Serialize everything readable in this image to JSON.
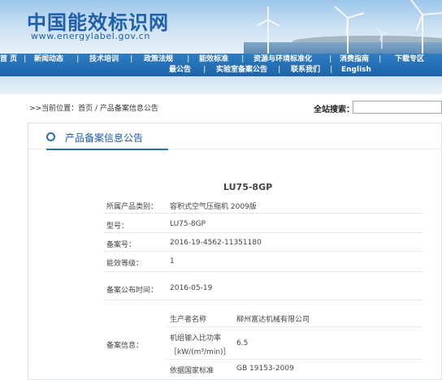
{
  "header": {
    "logo_title": "中国能效标识网",
    "logo_url": "www.energylabel.gov.cn"
  },
  "nav": {
    "row1": [
      "首 页",
      "新闻动态",
      "技术培训",
      "政策法规",
      "能效标准",
      "资源与环境标准化",
      "消费指南",
      "下载专区"
    ],
    "row2": [
      "最公告",
      "实验室备案公告",
      "联系我们",
      "English"
    ]
  },
  "breadcrumb": {
    "text": ">>当前位置：首页 / 产品备案信息公告"
  },
  "search": {
    "label": "全站搜索：",
    "value": "",
    "placeholder": ""
  },
  "panel": {
    "title": "产品备案信息公告"
  },
  "record": {
    "model_title": "LU75-8GP",
    "category_label": "所属产品类别：",
    "category_value": "容积式空气压缩机 2009版",
    "model_label": "型号：",
    "model_value": "LU75-8GP",
    "record_no_label": "备案号：",
    "record_no_value": "2016-19-4562-11351180",
    "grade_label": "能效等级：",
    "grade_value": "1",
    "publish_date_label": "备案公布时间：",
    "publish_date_value": "2016-05-19",
    "info_label": "备案信息：",
    "info": {
      "producer_label": "生产者名称",
      "producer_value": "柳州富达机械有限公司",
      "power_label_line1": "机组输入比功率",
      "power_label_line2": "［kW/(m³/min)］",
      "power_value": "6.5",
      "standard_label": "依据国家标准",
      "standard_value": "GB 19153-2009"
    }
  },
  "colors": {
    "brand_blue": "#1e5fa8",
    "nav_blue": "#1f63a8",
    "accent_ring": "#2a6fb8"
  }
}
